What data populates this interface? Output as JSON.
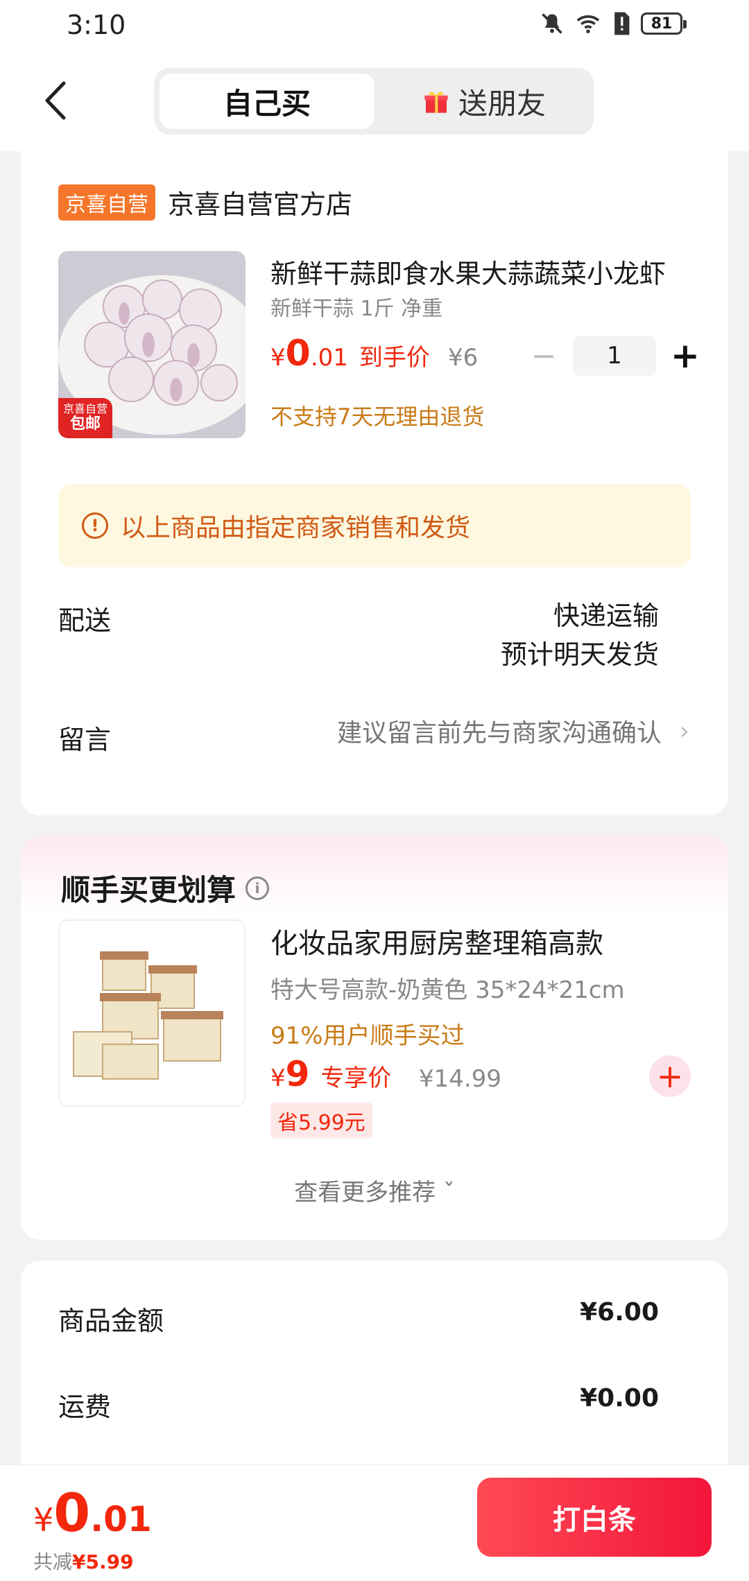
{
  "status_bar": {
    "time": "3:10",
    "battery": "81"
  },
  "header": {
    "tabs": [
      {
        "label": "自己买",
        "active": true
      },
      {
        "label": "送朋友",
        "active": false
      }
    ]
  },
  "order": {
    "shop_badge": "京喜自营",
    "shop_name": "京喜自营官方店",
    "product": {
      "image_badge_top": "京喜自营",
      "image_badge_bottom": "包邮",
      "title": "新鲜干蒜即食水果大蒜蔬菜小龙虾",
      "spec": "新鲜干蒜 1斤 净重",
      "price_currency": "¥",
      "price_int": "0",
      "price_dec": ".01",
      "price_label": "到手价",
      "original_price": "¥6",
      "quantity": "1",
      "return_policy": "不支持7天无理由退货"
    },
    "notice": "以上商品由指定商家销售和发货",
    "delivery": {
      "label": "配送",
      "method": "快递运输",
      "eta": "预计明天发货"
    },
    "remark": {
      "label": "留言",
      "placeholder": "建议留言前先与商家沟通确认"
    }
  },
  "recommend": {
    "title": "顺手买更划算",
    "item": {
      "title": "化妆品家用厨房整理箱高款",
      "spec": "特大号高款-奶黄色 35*24*21cm",
      "users": "91%用户顺手买过",
      "price_currency": "¥",
      "price_int": "9",
      "price_label": "专享价",
      "original_price": "¥14.99",
      "save": "省5.99元"
    },
    "more": "查看更多推荐"
  },
  "summary": {
    "rows": [
      {
        "label": "商品金额",
        "value": "¥6.00"
      },
      {
        "label": "运费",
        "value": "¥0.00"
      }
    ]
  },
  "bottom": {
    "currency": "¥",
    "total_int": "0",
    "total_dec": ".01",
    "save_label": "共减",
    "save_value": "¥5.99",
    "pay_button": "打白条"
  },
  "colors": {
    "accent": "#f2270c",
    "shop_badge": "#f5762a",
    "notice_bg": "#fff8e1",
    "warn_text": "#c87b16"
  }
}
